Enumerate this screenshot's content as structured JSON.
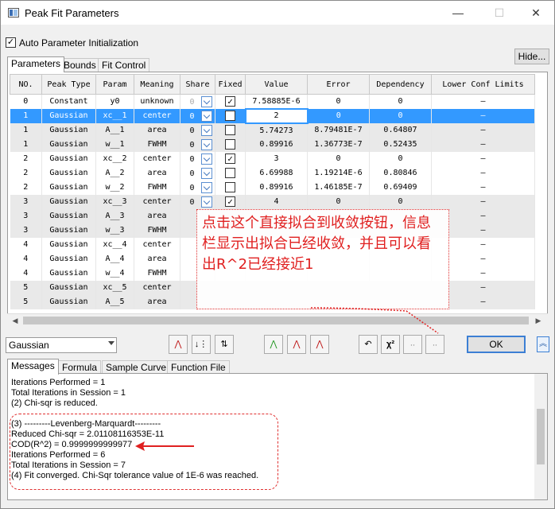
{
  "window": {
    "title": "Peak Fit Parameters",
    "minimize_glyph": "—",
    "maximize_glyph": "☐",
    "close_glyph": "✕"
  },
  "auto_param": {
    "label": "Auto Parameter Initialization",
    "checked": true
  },
  "hide_button": "Hide...",
  "tabs": [
    {
      "label": "Parameters",
      "active": true
    },
    {
      "label": "Bounds"
    },
    {
      "label": "Fit Control"
    }
  ],
  "columns": [
    "NO.",
    "Peak Type",
    "Param",
    "Meaning",
    "Share",
    "Fixed",
    "Value",
    "Error",
    "Dependency",
    "Lower Conf Limits"
  ],
  "rows": [
    {
      "no": "0",
      "type": "Constant",
      "param": "y0",
      "meaning": "unknown",
      "share": "0",
      "fixed": true,
      "value": "7.58885E-6",
      "error": "0",
      "dep": "0",
      "lcl": "—",
      "shade": false,
      "sel": false
    },
    {
      "no": "1",
      "type": "Gaussian",
      "param": "xc__1",
      "meaning": "center",
      "share": "0",
      "fixed": true,
      "value": "2",
      "error": "0",
      "dep": "0",
      "lcl": "—",
      "shade": false,
      "sel": true
    },
    {
      "no": "1",
      "type": "Gaussian",
      "param": "A__1",
      "meaning": "area",
      "share": "0",
      "fixed": false,
      "value": "5.74273",
      "error": "8.79481E-7",
      "dep": "0.64807",
      "lcl": "—",
      "shade": true,
      "sel": false
    },
    {
      "no": "1",
      "type": "Gaussian",
      "param": "w__1",
      "meaning": "FWHM",
      "share": "0",
      "fixed": false,
      "value": "0.89916",
      "error": "1.36773E-7",
      "dep": "0.52435",
      "lcl": "—",
      "shade": true,
      "sel": false
    },
    {
      "no": "2",
      "type": "Gaussian",
      "param": "xc__2",
      "meaning": "center",
      "share": "0",
      "fixed": true,
      "value": "3",
      "error": "0",
      "dep": "0",
      "lcl": "—",
      "shade": false,
      "sel": false
    },
    {
      "no": "2",
      "type": "Gaussian",
      "param": "A__2",
      "meaning": "area",
      "share": "0",
      "fixed": false,
      "value": "6.69988",
      "error": "1.19214E-6",
      "dep": "0.80846",
      "lcl": "—",
      "shade": false,
      "sel": false
    },
    {
      "no": "2",
      "type": "Gaussian",
      "param": "w__2",
      "meaning": "FWHM",
      "share": "0",
      "fixed": false,
      "value": "0.89916",
      "error": "1.46185E-7",
      "dep": "0.69409",
      "lcl": "—",
      "shade": false,
      "sel": false
    },
    {
      "no": "3",
      "type": "Gaussian",
      "param": "xc__3",
      "meaning": "center",
      "share": "0",
      "fixed": true,
      "value": "4",
      "error": "0",
      "dep": "0",
      "lcl": "—",
      "shade": true,
      "sel": false
    },
    {
      "no": "3",
      "type": "Gaussian",
      "param": "A__3",
      "meaning": "area",
      "share": "",
      "fixed": null,
      "value": "",
      "error": "",
      "dep": "",
      "lcl": "—",
      "shade": true,
      "sel": false
    },
    {
      "no": "3",
      "type": "Gaussian",
      "param": "w__3",
      "meaning": "FWHM",
      "share": "",
      "fixed": null,
      "value": "",
      "error": "",
      "dep": "",
      "lcl": "—",
      "shade": true,
      "sel": false
    },
    {
      "no": "4",
      "type": "Gaussian",
      "param": "xc__4",
      "meaning": "center",
      "share": "",
      "fixed": null,
      "value": "",
      "error": "",
      "dep": "",
      "lcl": "—",
      "shade": false,
      "sel": false
    },
    {
      "no": "4",
      "type": "Gaussian",
      "param": "A__4",
      "meaning": "area",
      "share": "",
      "fixed": null,
      "value": "",
      "error": "",
      "dep": "",
      "lcl": "—",
      "shade": false,
      "sel": false
    },
    {
      "no": "4",
      "type": "Gaussian",
      "param": "w__4",
      "meaning": "FWHM",
      "share": "",
      "fixed": null,
      "value": "",
      "error": "",
      "dep": "",
      "lcl": "—",
      "shade": false,
      "sel": false
    },
    {
      "no": "5",
      "type": "Gaussian",
      "param": "xc__5",
      "meaning": "center",
      "share": "",
      "fixed": null,
      "value": "",
      "error": "",
      "dep": "",
      "lcl": "—",
      "shade": true,
      "sel": false
    },
    {
      "no": "5",
      "type": "Gaussian",
      "param": "A__5",
      "meaning": "area",
      "share": "",
      "fixed": null,
      "value": "",
      "error": "",
      "dep": "",
      "lcl": "—",
      "shade": true,
      "sel": false
    }
  ],
  "callout_text": "点击这个直接拟合到收敛按钮，信息栏显示出拟合已经收敛，并且可以看出R^2已经接近1",
  "peak_type_select": "Gaussian",
  "toolbar_icons": [
    "add-peak-icon",
    "sort-peaks-icon",
    "merge-peaks-icon",
    "fit-peaks-icon",
    "fit-multi-icon",
    "fit-single-icon",
    "undo-icon",
    "chi-square-icon",
    "one-iteration-icon",
    "fit-until-converged-icon"
  ],
  "toolbar_glyphs": {
    "add": "⋀",
    "sort": "↓⋮",
    "merge": "⇅",
    "fit_peaks": "⋀",
    "fit_multi": "⋀",
    "fit_single": "⋀",
    "undo": "↶",
    "chi": "χ²",
    "one_iter": "⸳⸳",
    "until_conv": "⸳⸳"
  },
  "ok_button": "OK",
  "collapse_glyph": "︽",
  "message_tabs": [
    "Messages",
    "Formula",
    "Sample Curve",
    "Function File"
  ],
  "messages": [
    "Iterations Performed = 1",
    "Total Iterations in Session = 1",
    "(2) Chi-sqr is reduced.",
    "",
    "(3) ---------Levenberg-Marquardt---------",
    "Reduced Chi-sqr = 2.01108116353E-11",
    "COD(R^2) = 0.9999999999977",
    "Iterations Performed = 6",
    "Total Iterations in Session = 7",
    "(4) Fit converged. Chi-Sqr tolerance value of 1E-6 was reached."
  ],
  "colors": {
    "selection": "#3399ff",
    "annotation": "#e02020",
    "ok_border": "#3c7fd4"
  }
}
